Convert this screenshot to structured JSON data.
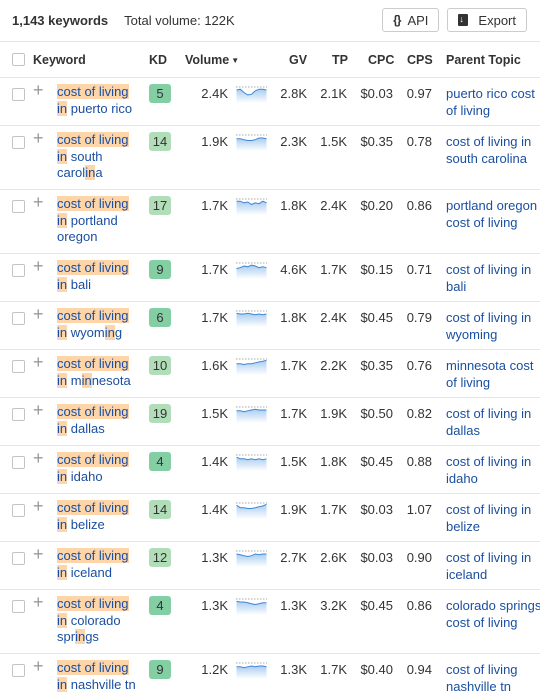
{
  "summary": {
    "keywords_count": "1,143 keywords",
    "total_volume": "Total volume: 122K"
  },
  "toolbar": {
    "api_label": "API",
    "api_icon": "{}",
    "export_label": "Export"
  },
  "columns": {
    "keyword": "Keyword",
    "kd": "KD",
    "volume": "Volume",
    "gv": "GV",
    "tp": "TP",
    "cpc": "CPC",
    "cps": "CPS",
    "parent_topic": "Parent Topic"
  },
  "colors": {
    "kd_easy": "#83cfa3",
    "kd_mid": "#b1deb8",
    "link": "#1a4fa1",
    "highlight": "#fdd5a8"
  },
  "rows": [
    {
      "keyword": [
        [
          "cost of living",
          "h"
        ],
        [
          "\n",
          ""
        ],
        [
          "in",
          "h"
        ],
        [
          " puerto rico",
          ""
        ]
      ],
      "kd": "5",
      "kd_level": "easy",
      "volume": "2.4K",
      "gv": "2.8K",
      "tp": "2.1K",
      "cpc": "$0.03",
      "cps": "0.97",
      "parent_topic": "puerto rico cost of living",
      "trend": [
        6,
        5,
        9,
        12,
        11,
        7,
        5,
        5,
        6
      ],
      "lines": 2,
      "pt_lines": 2
    },
    {
      "keyword": [
        [
          "cost of living",
          "h"
        ],
        [
          "\n",
          ""
        ],
        [
          "in",
          "h"
        ],
        [
          " south carol",
          ""
        ],
        [
          "in",
          "h"
        ],
        [
          "a",
          ""
        ]
      ],
      "kd": "14",
      "kd_level": "mid",
      "volume": "1.9K",
      "gv": "2.3K",
      "tp": "1.5K",
      "cpc": "$0.35",
      "cps": "0.78",
      "parent_topic": "cost of living in south carolina",
      "trend": [
        7,
        7,
        8,
        9,
        9,
        8,
        6,
        6,
        7
      ],
      "lines": 3,
      "pt_lines": 2
    },
    {
      "keyword": [
        [
          "cost of living",
          "h"
        ],
        [
          "\n",
          ""
        ],
        [
          "in",
          "h"
        ],
        [
          " portland oregon",
          ""
        ]
      ],
      "kd": "17",
      "kd_level": "mid",
      "volume": "1.7K",
      "gv": "1.8K",
      "tp": "2.4K",
      "cpc": "$0.20",
      "cps": "0.86",
      "parent_topic": "portland oregon cost of living",
      "trend": [
        5,
        5,
        7,
        6,
        9,
        7,
        8,
        5,
        7
      ],
      "lines": 3,
      "pt_lines": 2
    },
    {
      "keyword": [
        [
          "cost of living",
          "h"
        ],
        [
          "\n",
          ""
        ],
        [
          "in",
          "h"
        ],
        [
          " bali",
          ""
        ]
      ],
      "kd": "9",
      "kd_level": "easy",
      "volume": "1.7K",
      "gv": "4.6K",
      "tp": "1.7K",
      "cpc": "$0.15",
      "cps": "0.71",
      "parent_topic": "cost of living in bali",
      "trend": [
        9,
        8,
        6,
        7,
        5,
        6,
        8,
        7,
        8
      ],
      "lines": 2,
      "pt_lines": 2
    },
    {
      "keyword": [
        [
          "cost of living",
          "h"
        ],
        [
          "\n",
          ""
        ],
        [
          "in",
          "h"
        ],
        [
          " wyom",
          ""
        ],
        [
          "in",
          "h"
        ],
        [
          "g",
          ""
        ]
      ],
      "kd": "6",
      "kd_level": "easy",
      "volume": "1.7K",
      "gv": "1.8K",
      "tp": "2.4K",
      "cpc": "$0.45",
      "cps": "0.79",
      "parent_topic": "cost of living in wyoming",
      "trend": [
        5,
        6,
        6,
        5,
        6,
        7,
        6,
        7,
        6
      ],
      "lines": 2,
      "pt_lines": 2
    },
    {
      "keyword": [
        [
          "cost of living",
          "h"
        ],
        [
          "\n",
          ""
        ],
        [
          "in",
          "h"
        ],
        [
          " m",
          ""
        ],
        [
          "in",
          "h"
        ],
        [
          "nesota",
          ""
        ]
      ],
      "kd": "10",
      "kd_level": "mid",
      "volume": "1.6K",
      "gv": "1.7K",
      "tp": "2.2K",
      "cpc": "$0.35",
      "cps": "0.76",
      "parent_topic": "minnesota cost of living",
      "trend": [
        8,
        8,
        9,
        8,
        8,
        7,
        6,
        5,
        4
      ],
      "lines": 2,
      "pt_lines": 2
    },
    {
      "keyword": [
        [
          "cost of living",
          "h"
        ],
        [
          "\n",
          ""
        ],
        [
          "in",
          "h"
        ],
        [
          " dallas",
          ""
        ]
      ],
      "kd": "19",
      "kd_level": "mid",
      "volume": "1.5K",
      "gv": "1.7K",
      "tp": "1.9K",
      "cpc": "$0.50",
      "cps": "0.82",
      "parent_topic": "cost of living in dallas",
      "trend": [
        7,
        7,
        8,
        7,
        6,
        5,
        6,
        6,
        6
      ],
      "lines": 2,
      "pt_lines": 2
    },
    {
      "keyword": [
        [
          "cost of living",
          "h"
        ],
        [
          "\n",
          ""
        ],
        [
          "in",
          "h"
        ],
        [
          " idaho",
          ""
        ]
      ],
      "kd": "4",
      "kd_level": "easy",
      "volume": "1.4K",
      "gv": "1.5K",
      "tp": "1.8K",
      "cpc": "$0.45",
      "cps": "0.88",
      "parent_topic": "cost of living in idaho",
      "trend": [
        5,
        7,
        7,
        8,
        7,
        8,
        7,
        8,
        7
      ],
      "lines": 2,
      "pt_lines": 2
    },
    {
      "keyword": [
        [
          "cost of living",
          "h"
        ],
        [
          "\n",
          ""
        ],
        [
          "in",
          "h"
        ],
        [
          " belize",
          ""
        ]
      ],
      "kd": "14",
      "kd_level": "mid",
      "volume": "1.4K",
      "gv": "1.9K",
      "tp": "1.7K",
      "cpc": "$0.03",
      "cps": "1.07",
      "parent_topic": "cost of living in belize",
      "trend": [
        5,
        8,
        8,
        9,
        9,
        8,
        7,
        6,
        4
      ],
      "lines": 2,
      "pt_lines": 2
    },
    {
      "keyword": [
        [
          "cost of living",
          "h"
        ],
        [
          "\n",
          ""
        ],
        [
          "in",
          "h"
        ],
        [
          " iceland",
          ""
        ]
      ],
      "kd": "12",
      "kd_level": "mid",
      "volume": "1.3K",
      "gv": "2.7K",
      "tp": "2.6K",
      "cpc": "$0.03",
      "cps": "0.90",
      "parent_topic": "cost of living in iceland",
      "trend": [
        6,
        7,
        8,
        9,
        8,
        6,
        7,
        6,
        6
      ],
      "lines": 2,
      "pt_lines": 2
    },
    {
      "keyword": [
        [
          "cost of living",
          "h"
        ],
        [
          "\n",
          ""
        ],
        [
          "in",
          "h"
        ],
        [
          " colorado spr",
          ""
        ],
        [
          "in",
          "h"
        ],
        [
          "gs",
          ""
        ]
      ],
      "kd": "4",
      "kd_level": "easy",
      "volume": "1.3K",
      "gv": "1.3K",
      "tp": "3.2K",
      "cpc": "$0.45",
      "cps": "0.86",
      "parent_topic": "colorado springs cost of living",
      "trend": [
        5,
        6,
        6,
        7,
        8,
        9,
        8,
        7,
        7
      ],
      "lines": 3,
      "pt_lines": 2
    },
    {
      "keyword": [
        [
          "cost of living",
          "h"
        ],
        [
          "\n",
          ""
        ],
        [
          "in",
          "h"
        ],
        [
          " nashville tn",
          ""
        ]
      ],
      "kd": "9",
      "kd_level": "easy",
      "volume": "1.2K",
      "gv": "1.3K",
      "tp": "1.7K",
      "cpc": "$0.40",
      "cps": "0.94",
      "parent_topic": "cost of living nashville tn",
      "trend": [
        7,
        7,
        8,
        7,
        6,
        7,
        6,
        6,
        7
      ],
      "lines": 2,
      "pt_lines": 2
    }
  ]
}
